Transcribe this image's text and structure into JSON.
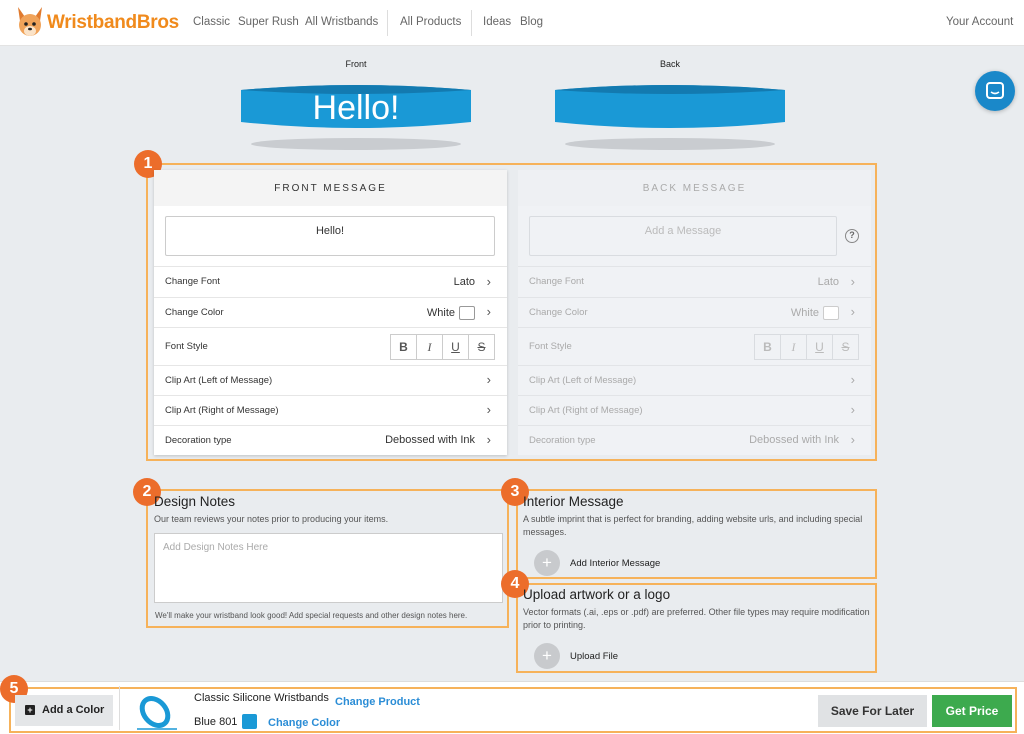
{
  "brand": {
    "name": "WristbandBros"
  },
  "nav": {
    "links": [
      "Classic",
      "Super Rush",
      "All Wristbands",
      "All Products",
      "Ideas",
      "Blog"
    ],
    "account": "Your Account"
  },
  "preview": {
    "front_label": "Front",
    "back_label": "Back",
    "front_text": "Hello!",
    "band_color": "#1a99d6"
  },
  "badges": [
    "1",
    "2",
    "3",
    "4",
    "5"
  ],
  "front": {
    "title": "FRONT MESSAGE",
    "message": "Hello!",
    "change_font_label": "Change Font",
    "font_value": "Lato",
    "change_color_label": "Change Color",
    "color_value": "White",
    "font_style_label": "Font Style",
    "style_buttons": [
      "B",
      "I",
      "U",
      "S"
    ],
    "clip_left_label": "Clip Art (Left of Message)",
    "clip_right_label": "Clip Art (Right of Message)",
    "decoration_label": "Decoration type",
    "decoration_value": "Debossed with Ink"
  },
  "back": {
    "title": "BACK MESSAGE",
    "placeholder": "Add a Message",
    "help": "?",
    "change_font_label": "Change Font",
    "font_value": "Lato",
    "change_color_label": "Change Color",
    "color_value": "White",
    "font_style_label": "Font Style",
    "style_buttons": [
      "B",
      "I",
      "U",
      "S"
    ],
    "clip_left_label": "Clip Art (Left of Message)",
    "clip_right_label": "Clip Art (Right of Message)",
    "decoration_label": "Decoration type",
    "decoration_value": "Debossed with Ink"
  },
  "design_notes": {
    "title": "Design Notes",
    "description": "Our team reviews your notes prior to producing your items.",
    "placeholder": "Add Design Notes Here",
    "footer": "We'll make your wristband look good! Add special requests and other design notes here."
  },
  "interior": {
    "title": "Interior Message",
    "description": "A subtle imprint that is perfect for branding, adding website urls, and including special messages.",
    "add_label": "Add Interior Message"
  },
  "upload": {
    "title": "Upload artwork or a logo",
    "description": "Vector formats (.ai, .eps or .pdf) are preferred. Other file types may require modification prior to printing.",
    "add_label": "Upload File"
  },
  "bottom": {
    "add_color": "Add a Color",
    "product_name": "Classic Silicone Wristbands",
    "change_product": "Change Product",
    "color_name": "Blue 801",
    "color_hex": "#1a99d6",
    "change_color": "Change Color",
    "save_later": "Save For Later",
    "get_price": "Get Price"
  },
  "colors": {
    "accent_orange": "#ec6d2b",
    "highlight": "#f6b25a",
    "link_blue": "#2b8dd6",
    "price_green": "#3daa4e"
  }
}
